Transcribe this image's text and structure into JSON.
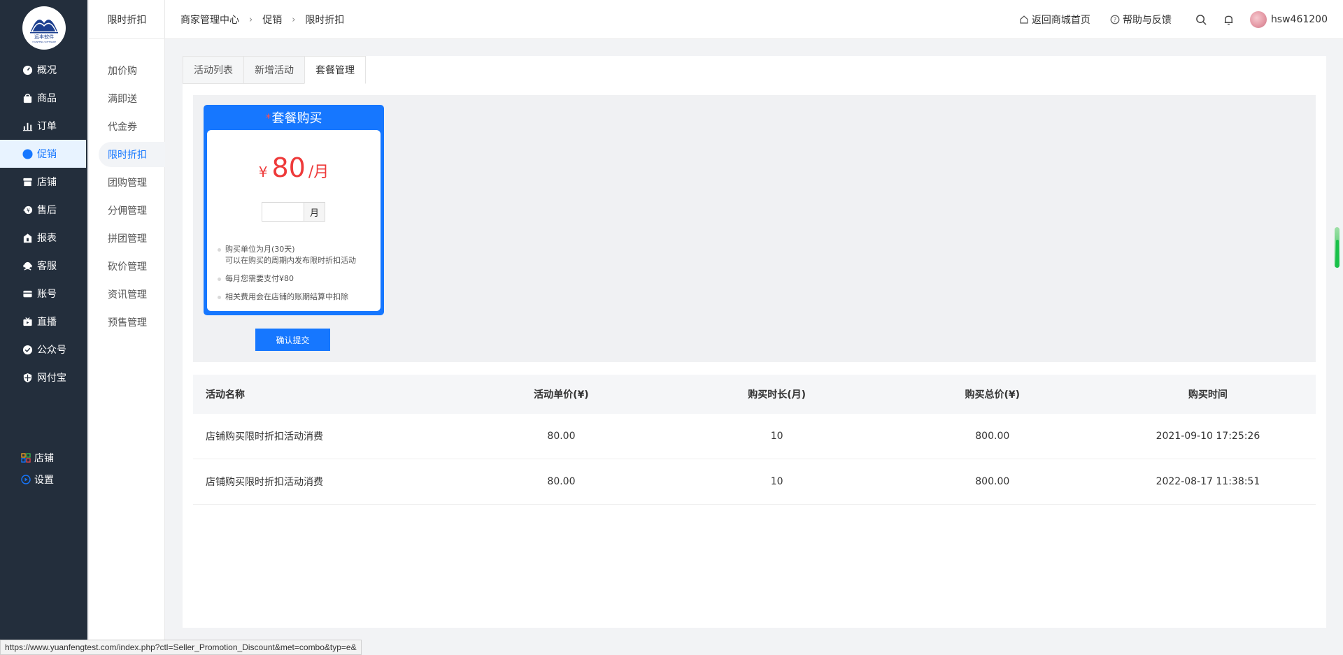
{
  "brand": {
    "logo_text": "远丰软件",
    "logo_subtext": "YUANFENG SOFTWARE"
  },
  "leftnav": {
    "items": [
      {
        "label": "概况",
        "icon": "dashboard-icon"
      },
      {
        "label": "商品",
        "icon": "bag-icon"
      },
      {
        "label": "订单",
        "icon": "bar-chart-icon"
      },
      {
        "label": "促销",
        "icon": "promo-icon",
        "active": true
      },
      {
        "label": "店铺",
        "icon": "store-icon"
      },
      {
        "label": "售后",
        "icon": "aftersale-icon"
      },
      {
        "label": "报表",
        "icon": "report-icon"
      },
      {
        "label": "客服",
        "icon": "service-icon"
      },
      {
        "label": "账号",
        "icon": "card-icon"
      },
      {
        "label": "直播",
        "icon": "live-icon"
      },
      {
        "label": "公众号",
        "icon": "badge-icon"
      },
      {
        "label": "网付宝",
        "icon": "shield-icon"
      }
    ],
    "bottom": [
      {
        "label": "店铺",
        "icon": "grid-icon"
      },
      {
        "label": "设置",
        "icon": "settings-icon"
      }
    ]
  },
  "subnav": {
    "title": "限时折扣",
    "items": [
      "加价购",
      "满即送",
      "代金券",
      "限时折扣",
      "团购管理",
      "分佣管理",
      "拼团管理",
      "砍价管理",
      "资讯管理",
      "预售管理"
    ],
    "active_index": 3
  },
  "header": {
    "breadcrumb": [
      "商家管理中心",
      "促销",
      "限时折扣"
    ],
    "links": {
      "home": "返回商城首页",
      "help": "帮助与反馈"
    },
    "username": "hsw461200"
  },
  "tabs": [
    "活动列表",
    "新增活动",
    "套餐管理"
  ],
  "active_tab": 2,
  "package": {
    "title_star": "*",
    "title": "套餐购买",
    "currency": "¥",
    "price": "80",
    "per_unit": "/月",
    "qty_value": "",
    "qty_unit": "月",
    "notes": [
      [
        "购买单位为月(30天)",
        "可以在购买的周期内发布限时折扣活动"
      ],
      [
        "每月您需要支付¥80"
      ],
      [
        "相关费用会在店铺的账期结算中扣除"
      ]
    ],
    "submit_label": "确认提交"
  },
  "table": {
    "headers": [
      "活动名称",
      "活动单价(¥)",
      "购买时长(月)",
      "购买总价(¥)",
      "购买时间"
    ],
    "rows": [
      [
        "店铺购买限时折扣活动消费",
        "80.00",
        "10",
        "800.00",
        "2021-09-10 17:25:26"
      ],
      [
        "店铺购买限时折扣活动消费",
        "80.00",
        "10",
        "800.00",
        "2022-08-17 11:38:51"
      ]
    ]
  },
  "status_url": "https://www.yuanfengtest.com/index.php?ctl=Seller_Promotion_Discount&met=combo&typ=e&",
  "colors": {
    "nav_bg": "#232e3c",
    "accent": "#1677ff",
    "price": "#ee3a3a"
  }
}
